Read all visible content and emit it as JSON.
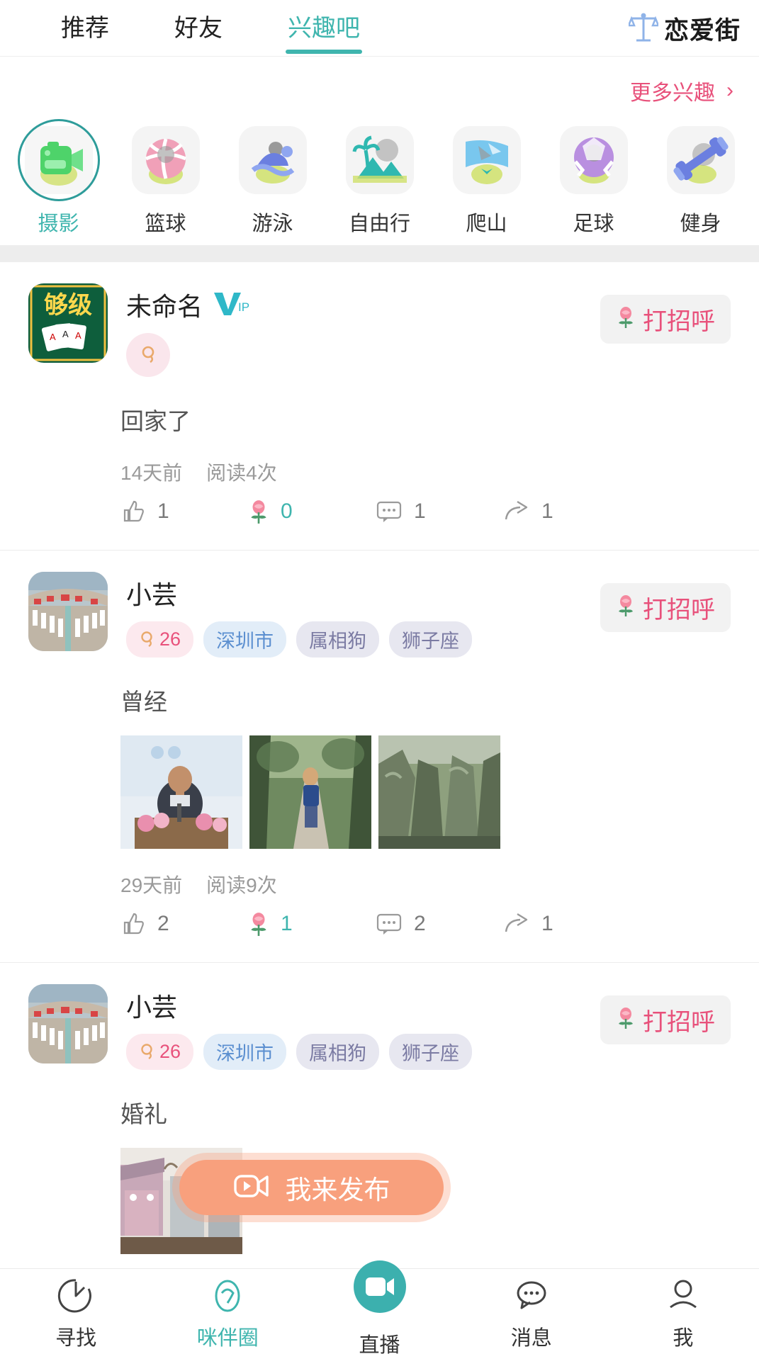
{
  "header": {
    "tabs": [
      {
        "label": "推荐",
        "active": false
      },
      {
        "label": "好友",
        "active": false
      },
      {
        "label": "兴趣吧",
        "active": true
      }
    ],
    "brand": {
      "label": "恋爱街",
      "icon": "balance-scale-icon",
      "icon_color": "#8FB3E8"
    }
  },
  "interest": {
    "more_label": "更多兴趣",
    "more_chevron": "›",
    "categories": [
      {
        "label": "摄影",
        "icon": "camera-icon",
        "active": true
      },
      {
        "label": "篮球",
        "icon": "basketball-icon",
        "active": false
      },
      {
        "label": "游泳",
        "icon": "swimming-icon",
        "active": false
      },
      {
        "label": "自由行",
        "icon": "palm-island-icon",
        "active": false
      },
      {
        "label": "爬山",
        "icon": "mountain-climb-icon",
        "active": false
      },
      {
        "label": "足球",
        "icon": "soccer-ball-icon",
        "active": false
      },
      {
        "label": "健身",
        "icon": "dumbbell-icon",
        "active": false
      }
    ]
  },
  "feed": {
    "greet_label": "打招呼",
    "greet_icon": "rose-icon",
    "posts": [
      {
        "user": "未命名",
        "vip_badge": "VIP",
        "avatar": "card-game-app-icon",
        "tags": [
          {
            "type": "round",
            "label": "",
            "icon": "female-gender-icon"
          }
        ],
        "text": "回家了",
        "images": [],
        "time": "14天前",
        "views": "阅读4次",
        "stats": [
          {
            "icon": "thumbs-up-icon",
            "value": "1",
            "accent": false
          },
          {
            "icon": "rose-icon",
            "value": "0",
            "accent": true
          },
          {
            "icon": "comment-icon",
            "value": "1",
            "accent": false
          },
          {
            "icon": "share-icon",
            "value": "1",
            "accent": false
          }
        ]
      },
      {
        "user": "小芸",
        "vip_badge": "",
        "avatar": "crowd-photo",
        "tags": [
          {
            "type": "age",
            "label": "26",
            "icon": "female-gender-icon"
          },
          {
            "type": "city",
            "label": "深圳市",
            "icon": ""
          },
          {
            "type": "plain",
            "label": "属相狗",
            "icon": ""
          },
          {
            "type": "plain",
            "label": "狮子座",
            "icon": ""
          }
        ],
        "text": "曾经",
        "images": [
          "speaker-podium-photo",
          "man-on-path-photo",
          "cliff-mountain-photo"
        ],
        "time": "29天前",
        "views": "阅读9次",
        "stats": [
          {
            "icon": "thumbs-up-icon",
            "value": "2",
            "accent": false
          },
          {
            "icon": "rose-icon",
            "value": "1",
            "accent": true
          },
          {
            "icon": "comment-icon",
            "value": "2",
            "accent": false
          },
          {
            "icon": "share-icon",
            "value": "1",
            "accent": false
          }
        ]
      },
      {
        "user": "小芸",
        "vip_badge": "",
        "avatar": "crowd-photo",
        "tags": [
          {
            "type": "age",
            "label": "26",
            "icon": "female-gender-icon"
          },
          {
            "type": "city",
            "label": "深圳市",
            "icon": ""
          },
          {
            "type": "plain",
            "label": "属相狗",
            "icon": ""
          },
          {
            "type": "plain",
            "label": "狮子座",
            "icon": ""
          }
        ],
        "text": "婚礼",
        "images": [
          "wedding-arch-photo"
        ],
        "time": "",
        "views": "",
        "stats": []
      }
    ]
  },
  "publish": {
    "label": "我来发布",
    "icon": "video-camera-icon",
    "color": "#F8A07D"
  },
  "bottomnav": {
    "items": [
      {
        "label": "寻找",
        "icon": "compass-icon",
        "active": false,
        "center": false
      },
      {
        "label": "咪伴圈",
        "icon": "circle-ring-icon",
        "active": true,
        "center": false
      },
      {
        "label": "直播",
        "icon": "live-video-icon",
        "active": false,
        "center": true
      },
      {
        "label": "消息",
        "icon": "chat-bubble-icon",
        "active": false,
        "center": false
      },
      {
        "label": "我",
        "icon": "person-icon",
        "active": false,
        "center": false
      }
    ]
  },
  "colors": {
    "accent": "#3FB5AE",
    "pink": "#E8517B",
    "orange": "#F8A07D",
    "blue": "#5B8FD0"
  }
}
